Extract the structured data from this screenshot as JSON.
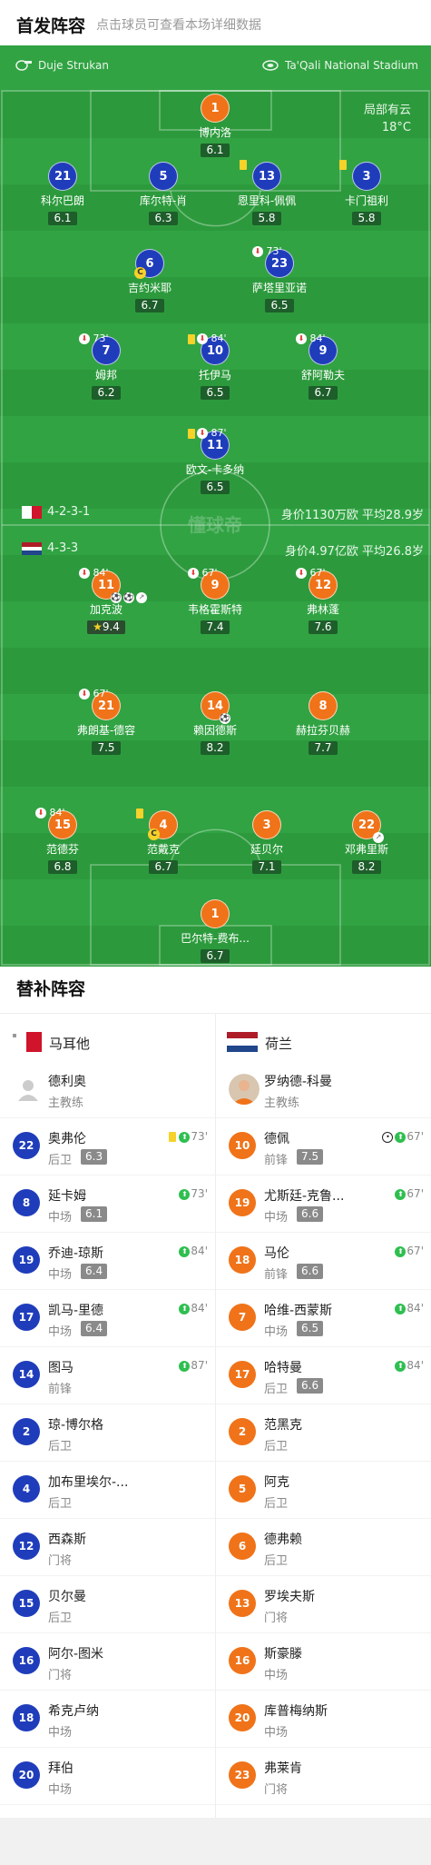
{
  "header": {
    "title": "首发阵容",
    "subtitle": "点击球员可查看本场详细数据"
  },
  "pitch": {
    "home_coach": "Duje Strukan",
    "venue": "Ta'Qali National Stadium",
    "weather": "局部有云",
    "temperature": "18°C",
    "watermark": "懂球帝",
    "home_formation": "4-2-3-1",
    "home_value": "身价1130万欧  平均28.9岁",
    "away_formation": "4-3-3",
    "away_value": "身价4.97亿欧  平均26.8岁"
  },
  "home_players": [
    {
      "num": "1",
      "name": "博内洛",
      "rating": "6.1"
    },
    {
      "num": "21",
      "name": "科尔巴朗",
      "rating": "6.1"
    },
    {
      "num": "5",
      "name": "库尔特-肖",
      "rating": "6.3"
    },
    {
      "num": "13",
      "name": "恩里科-佩佩",
      "rating": "5.8"
    },
    {
      "num": "3",
      "name": "卡门祖利",
      "rating": "5.8"
    },
    {
      "num": "6",
      "name": "吉约米耶",
      "rating": "6.7"
    },
    {
      "num": "23",
      "name": "萨塔里亚诺",
      "rating": "6.5",
      "event": "73'"
    },
    {
      "num": "7",
      "name": "姆邦",
      "rating": "6.2",
      "event": "73'"
    },
    {
      "num": "10",
      "name": "托伊马",
      "rating": "6.5",
      "event": "84'"
    },
    {
      "num": "9",
      "name": "舒阿勒夫",
      "rating": "6.7",
      "event": "84'"
    },
    {
      "num": "11",
      "name": "欧文-卡多纳",
      "rating": "6.5",
      "event": "87'"
    }
  ],
  "away_players": [
    {
      "num": "11",
      "name": "加克波",
      "rating": "9.4",
      "event": "84'"
    },
    {
      "num": "9",
      "name": "韦格霍斯特",
      "rating": "7.4",
      "event": "67'"
    },
    {
      "num": "12",
      "name": "弗林蓬",
      "rating": "7.6",
      "event": "67'"
    },
    {
      "num": "21",
      "name": "弗朗基-德容",
      "rating": "7.5",
      "event": "67'"
    },
    {
      "num": "14",
      "name": "赖因德斯",
      "rating": "8.2"
    },
    {
      "num": "8",
      "name": "赫拉芬贝赫",
      "rating": "7.7"
    },
    {
      "num": "15",
      "name": "范德芬",
      "rating": "6.8",
      "event": "84'"
    },
    {
      "num": "4",
      "name": "范戴克",
      "rating": "6.7"
    },
    {
      "num": "3",
      "name": "廷贝尔",
      "rating": "7.1"
    },
    {
      "num": "22",
      "name": "邓弗里斯",
      "rating": "8.2"
    },
    {
      "num": "1",
      "name": "巴尔特-费布...",
      "rating": "6.7"
    }
  ],
  "bench": {
    "title": "替补阵容",
    "home_team": "马耳他",
    "away_team": "荷兰",
    "home_coach": {
      "name": "德利奥",
      "role": "主教练"
    },
    "away_coach": {
      "name": "罗纳德-科曼",
      "role": "主教练"
    },
    "home": [
      {
        "num": "22",
        "name": "奥弗伦",
        "pos": "后卫",
        "rating": "6.3",
        "time": "73'"
      },
      {
        "num": "8",
        "name": "延卡姆",
        "pos": "中场",
        "rating": "6.1",
        "time": "73'"
      },
      {
        "num": "19",
        "name": "乔迪-琼斯",
        "pos": "中场",
        "rating": "6.4",
        "time": "84'"
      },
      {
        "num": "17",
        "name": "凯马-里德",
        "pos": "中场",
        "rating": "6.4",
        "time": "84'"
      },
      {
        "num": "14",
        "name": "图马",
        "pos": "前锋",
        "time": "87'"
      },
      {
        "num": "2",
        "name": "琼-博尔格",
        "pos": "后卫"
      },
      {
        "num": "4",
        "name": "加布里埃尔-...",
        "pos": "后卫"
      },
      {
        "num": "12",
        "name": "西森斯",
        "pos": "门将"
      },
      {
        "num": "15",
        "name": "贝尔曼",
        "pos": "后卫"
      },
      {
        "num": "16",
        "name": "阿尔-图米",
        "pos": "门将"
      },
      {
        "num": "18",
        "name": "希克卢纳",
        "pos": "中场"
      },
      {
        "num": "20",
        "name": "拜伯",
        "pos": "中场"
      }
    ],
    "away": [
      {
        "num": "10",
        "name": "德佩",
        "pos": "前锋",
        "rating": "7.5",
        "time": "67'"
      },
      {
        "num": "19",
        "name": "尤斯廷-克鲁...",
        "pos": "中场",
        "rating": "6.6",
        "time": "67'"
      },
      {
        "num": "18",
        "name": "马伦",
        "pos": "前锋",
        "rating": "6.6",
        "time": "67'"
      },
      {
        "num": "7",
        "name": "哈维-西蒙斯",
        "pos": "中场",
        "rating": "6.5",
        "time": "84'"
      },
      {
        "num": "17",
        "name": "哈特曼",
        "pos": "后卫",
        "rating": "6.6",
        "time": "84'"
      },
      {
        "num": "2",
        "name": "范黑克",
        "pos": "后卫"
      },
      {
        "num": "5",
        "name": "阿克",
        "pos": "后卫"
      },
      {
        "num": "6",
        "name": "德弗赖",
        "pos": "后卫"
      },
      {
        "num": "13",
        "name": "罗埃夫斯",
        "pos": "门将"
      },
      {
        "num": "16",
        "name": "斯豪滕",
        "pos": "中场"
      },
      {
        "num": "20",
        "name": "库普梅纳斯",
        "pos": "中场"
      },
      {
        "num": "23",
        "name": "弗莱肯",
        "pos": "门将"
      }
    ]
  },
  "colors": {
    "home": "#1f3dbb",
    "away": "#f07319",
    "pitch": "#2c9a3c"
  }
}
